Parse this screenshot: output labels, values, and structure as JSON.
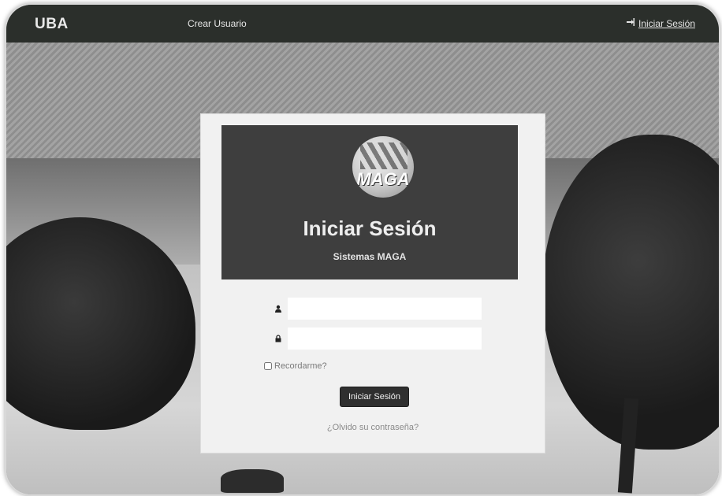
{
  "navbar": {
    "brand": "UBA",
    "links": [
      {
        "label": "Crear Usuario"
      }
    ],
    "login_label": "Iniciar Sesión"
  },
  "login_card": {
    "logo_text": "MAGA",
    "title": "Iniciar Sesión",
    "subtitle": "Sistemas MAGA",
    "username": {
      "value": "",
      "placeholder": ""
    },
    "password": {
      "value": "",
      "placeholder": ""
    },
    "remember_label": "Recordarme?",
    "submit_label": "Iniciar Sesión",
    "forgot_label": "¿Olvido su contraseña?"
  },
  "colors": {
    "navbar_bg": "#2b2f2b",
    "header_bg": "#3e3e3e",
    "button_bg": "#2f2f2f"
  },
  "icons": {
    "user": "user-icon",
    "lock": "lock-icon",
    "login": "sign-in-icon"
  }
}
